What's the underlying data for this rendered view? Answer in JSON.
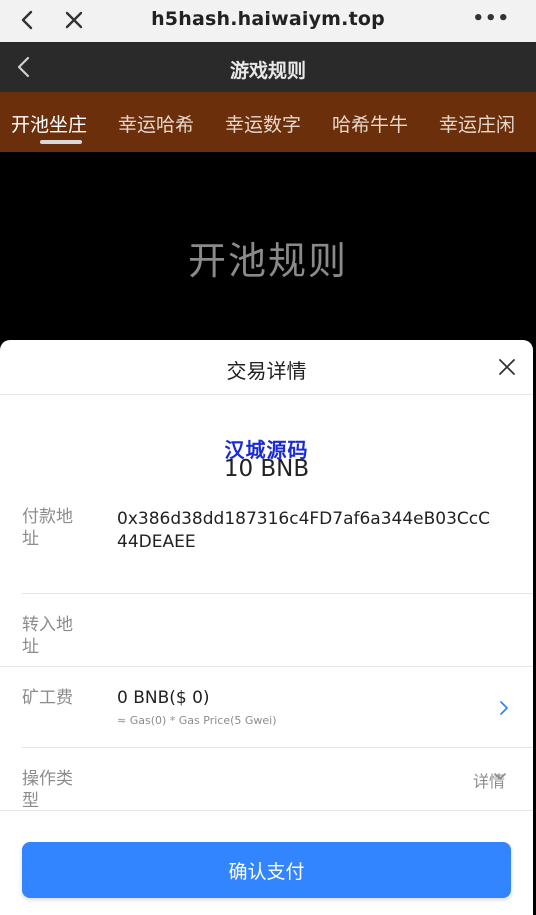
{
  "browser": {
    "url": "h5hash.haiwaiym.top",
    "more": "•••"
  },
  "app": {
    "title": "游戏规则"
  },
  "tabs": [
    {
      "label": "开池坐庄"
    },
    {
      "label": "幸运哈希"
    },
    {
      "label": "幸运数字"
    },
    {
      "label": "哈希牛牛"
    },
    {
      "label": "幸运庄闲"
    }
  ],
  "page": {
    "heading": "开池规则"
  },
  "sheet": {
    "title": "交易详情",
    "watermark": "汉城源码",
    "amount": "10 BNB",
    "pay_address_label": "付款地址",
    "pay_address_line1": "0x386d38dd187316c4FD7af6a344eB03CcC",
    "pay_address_line2": "44DEAEE",
    "to_address_label": "转入地址",
    "to_address_value": "",
    "fee_label": "矿工费",
    "fee_value": "0 BNB($ 0)",
    "fee_sub": "≈ Gas(0) * Gas Price(5 Gwei)",
    "op_type_label": "操作类型",
    "op_type_detail": "详情",
    "confirm_label": "确认支付"
  },
  "colors": {
    "tab_bar": "#6b2f0b",
    "primary_button": "#3385ff",
    "watermark": "#1a2bd6"
  }
}
